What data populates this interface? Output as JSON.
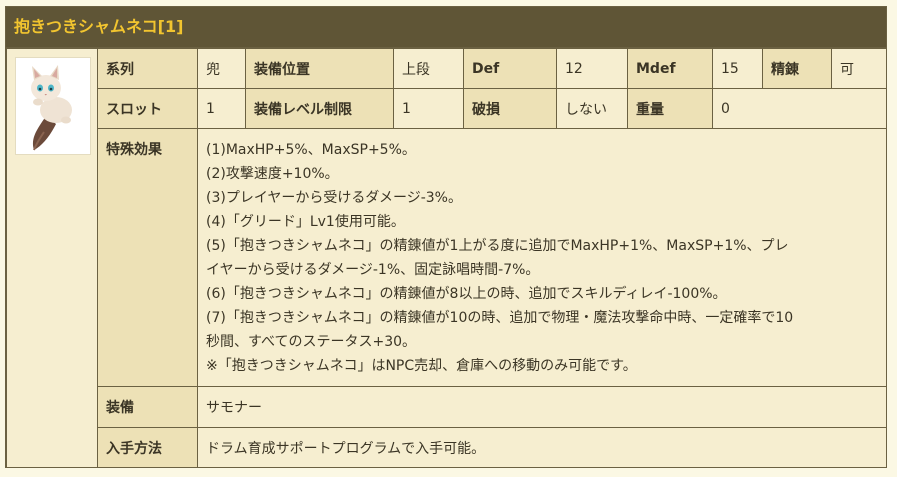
{
  "title": "抱きつきシャムネコ[1]",
  "row1": {
    "type_label": "系列",
    "type_value": "兜",
    "position_label": "装備位置",
    "position_value": "上段",
    "def_label": "Def",
    "def_value": "12",
    "mdef_label": "Mdef",
    "mdef_value": "15",
    "refine_label": "精錬",
    "refine_value": "可"
  },
  "row2": {
    "slot_label": "スロット",
    "slot_value": "1",
    "level_label": "装備レベル制限",
    "level_value": "1",
    "breakable_label": "破損",
    "breakable_value": "しない",
    "weight_label": "重量",
    "weight_value": "0"
  },
  "effects": {
    "label": "特殊効果",
    "lines": [
      "(1)MaxHP+5%、MaxSP+5%。",
      "(2)攻撃速度+10%。",
      "(3)プレイヤーから受けるダメージ-3%。",
      "(4)「グリード」Lv1使用可能。",
      "(5)「抱きつきシャムネコ」の精錬値が1上がる度に追加でMaxHP+1%、MaxSP+1%、プレ",
      "イヤーから受けるダメージ-1%、固定詠唱時間-7%。",
      "(6)「抱きつきシャムネコ」の精錬値が8以上の時、追加でスキルディレイ-100%。",
      "(7)「抱きつきシャムネコ」の精錬値が10の時、追加で物理・魔法攻撃命中時、一定確率で10",
      "秒間、すべてのステータス+30。",
      "※「抱きつきシャムネコ」はNPC売却、倉庫への移動のみ可能です。"
    ]
  },
  "equip": {
    "label": "装備",
    "value": "サモナー"
  },
  "obtain": {
    "label": "入手方法",
    "value": "ドラム育成サポートプログラムで入手可能。"
  }
}
